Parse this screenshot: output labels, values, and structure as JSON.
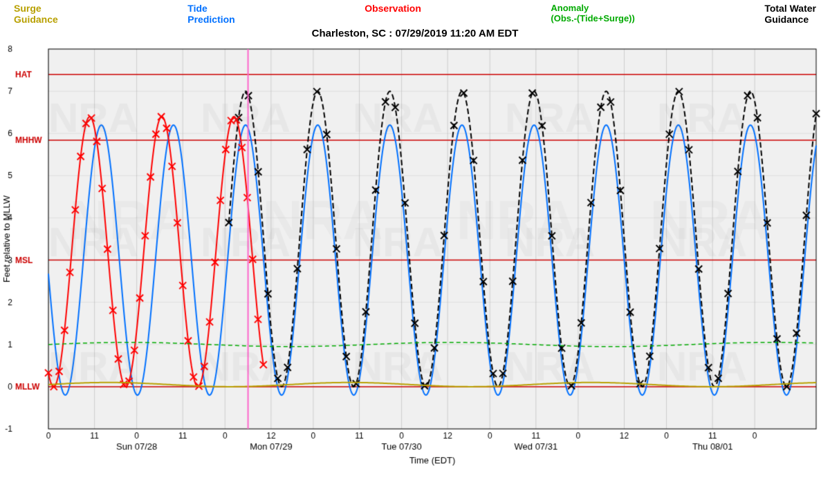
{
  "legend": {
    "surge": [
      "Surge",
      "Guidance"
    ],
    "tide": [
      "Tide",
      "Prediction"
    ],
    "observation": "Observation",
    "anomaly": [
      "Anomaly",
      "(Obs.-(Tide+Surge))"
    ],
    "total": [
      "Total Water",
      "Guidance"
    ]
  },
  "subtitle": "Charleston, SC : 07/29/2019 11:20 AM EDT",
  "chart": {
    "yMin": -1,
    "yMax": 8,
    "yLabels": [
      -1,
      0,
      1,
      2,
      3,
      4,
      5,
      6,
      7,
      8
    ],
    "yAxisLabel": "Feet relative to MLLW",
    "xAxisLabel": "Time (EDT)",
    "referenceLines": {
      "HAT": 7.4,
      "MHHW": 5.84,
      "MSL": 3.0,
      "MLLW": 0.0
    },
    "days": [
      {
        "label": "Sun 07/28",
        "xFrac": 0.08
      },
      {
        "label": "Mon 07/29",
        "xFrac": 0.28
      },
      {
        "label": "Tue 07/30",
        "xFrac": 0.48
      },
      {
        "label": "Wed 07/31",
        "xFrac": 0.68
      },
      {
        "label": "Thu 08/01",
        "xFrac": 0.88
      }
    ]
  }
}
